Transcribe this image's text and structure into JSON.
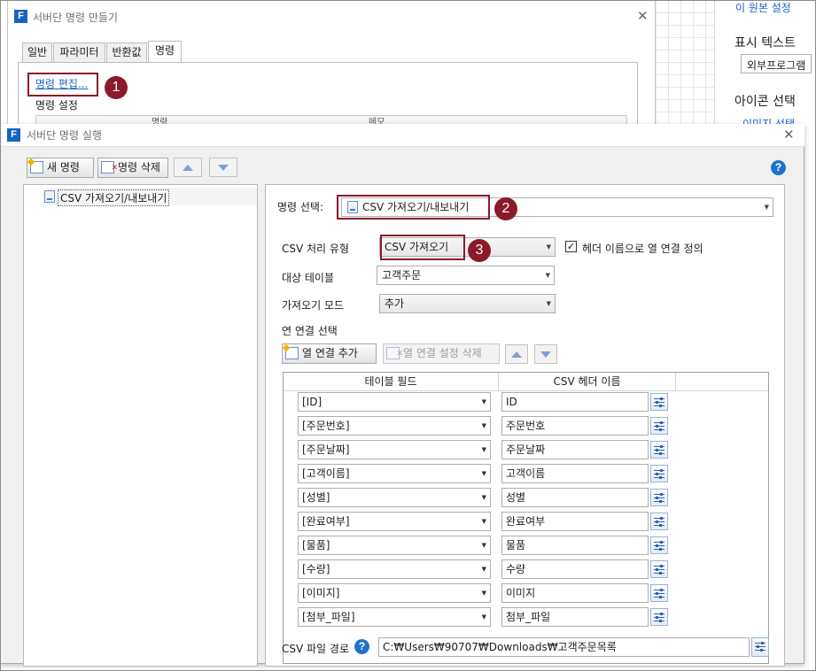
{
  "background": {
    "right_link_top": "이 원본 설정",
    "display_text_label": "표시 텍스트",
    "display_text_value": "외부프로그램",
    "icon_select_label": "아이콘 선택",
    "image_select_link": "이미지 선택"
  },
  "dialog1": {
    "title": "서버단 명령 만들기",
    "close": "✕",
    "tabs": [
      "일반",
      "파라미터",
      "반환값",
      "명령"
    ],
    "edit_link": "명령 편집...",
    "settings_label": "명령 설정",
    "grid_headers": [
      "명령",
      "메모"
    ],
    "badge": "1"
  },
  "dialog2": {
    "title": "서버단 명령 실행",
    "close": "✕",
    "toolbar": {
      "new_label": "새 명령",
      "delete_label": "명령 삭제",
      "help": "?"
    },
    "tree": {
      "item": "CSV 가져오기/내보내기"
    },
    "command_select": {
      "label": "명령 선택:",
      "value": "CSV 가져오기/내보내기",
      "badge": "2"
    },
    "csv_type": {
      "label": "CSV 처리 유형",
      "value": "CSV 가져오기",
      "badge": "3",
      "checkbox_checked": true,
      "checkbox_mark": "✓",
      "checkbox_label": "헤더 이름으로 열 연결 정의"
    },
    "target_table": {
      "label": "대상 테이블",
      "value": "고객주문"
    },
    "import_mode": {
      "label": "가져오기 모드",
      "value": "추가"
    },
    "column_map": {
      "label": "연 연결 선택",
      "add_label": "열 연결 추가",
      "delete_label": "열 연결 설정 삭제"
    },
    "table": {
      "headers": [
        "테이블 필드",
        "CSV 헤더 이름"
      ],
      "rows": [
        {
          "field": "[ID]",
          "csv": "ID"
        },
        {
          "field": "[주문번호]",
          "csv": "주문번호"
        },
        {
          "field": "[주문날짜]",
          "csv": "주문날짜"
        },
        {
          "field": "[고객이름]",
          "csv": "고객이름"
        },
        {
          "field": "[성별]",
          "csv": "성별"
        },
        {
          "field": "[완료여부]",
          "csv": "완료여부"
        },
        {
          "field": "[물품]",
          "csv": "물품"
        },
        {
          "field": "[수량]",
          "csv": "수량"
        },
        {
          "field": "[이미지]",
          "csv": "이미지"
        },
        {
          "field": "[첨부_파일]",
          "csv": "첨부_파일"
        }
      ]
    },
    "csv_path": {
      "label": "CSV 파일 경로",
      "help": "?",
      "value": "C:₩Users₩90707₩Downloads₩고객주문목록"
    }
  }
}
